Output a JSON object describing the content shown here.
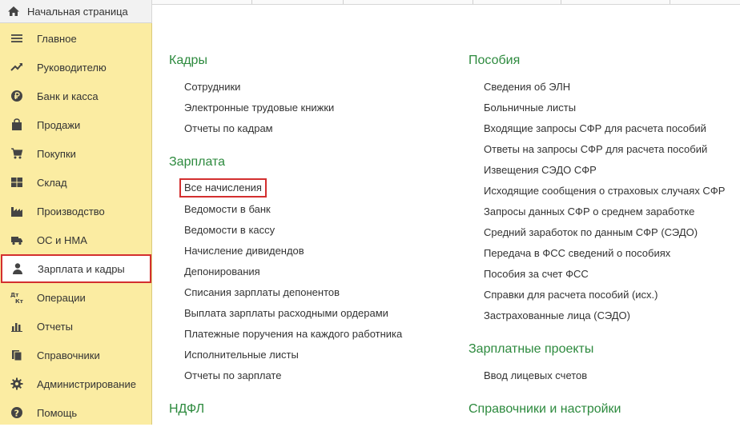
{
  "top_bar": {
    "home_label": "Начальная страница"
  },
  "sidebar": {
    "items": [
      {
        "label": "Главное",
        "icon": "menu-icon"
      },
      {
        "label": "Руководителю",
        "icon": "trend-icon"
      },
      {
        "label": "Банк и касса",
        "icon": "ruble-icon"
      },
      {
        "label": "Продажи",
        "icon": "bag-icon"
      },
      {
        "label": "Покупки",
        "icon": "cart-icon"
      },
      {
        "label": "Склад",
        "icon": "grid-icon"
      },
      {
        "label": "Производство",
        "icon": "factory-icon"
      },
      {
        "label": "ОС и НМА",
        "icon": "truck-icon"
      },
      {
        "label": "Зарплата и кадры",
        "icon": "person-icon",
        "active": true
      },
      {
        "label": "Операции",
        "icon": "dt-kt-icon"
      },
      {
        "label": "Отчеты",
        "icon": "bar-chart-icon"
      },
      {
        "label": "Справочники",
        "icon": "books-icon"
      },
      {
        "label": "Администрирование",
        "icon": "gear-icon"
      },
      {
        "label": "Помощь",
        "icon": "help-icon"
      }
    ]
  },
  "left_column": {
    "kadry": {
      "title": "Кадры",
      "links": [
        "Сотрудники",
        "Электронные трудовые книжки",
        "Отчеты по кадрам"
      ]
    },
    "zarplata": {
      "title": "Зарплата",
      "links": [
        "Все начисления",
        "Ведомости в банк",
        "Ведомости в кассу",
        "Начисление дивидендов",
        "Депонирования",
        "Списания зарплаты депонентов",
        "Выплата зарплаты расходными ордерами",
        "Платежные поручения на каждого работника",
        "Исполнительные листы",
        "Отчеты по зарплате"
      ]
    },
    "ndfl": {
      "title": "НДФЛ"
    }
  },
  "right_column": {
    "posobiya": {
      "title": "Пособия",
      "links": [
        "Сведения об ЭЛН",
        "Больничные листы",
        "Входящие запросы СФР для расчета пособий",
        "Ответы на запросы СФР для расчета пособий",
        "Извещения СЭДО СФР",
        "Исходящие сообщения о страховых случаях СФР",
        "Запросы данных СФР о среднем заработке",
        "Средний заработок по данным СФР (СЭДО)",
        "Передача в ФСС сведений о пособиях",
        "Пособия за счет ФСС",
        "Справки для расчета пособий (исх.)",
        "Застрахованные лица (СЭДО)"
      ]
    },
    "projects": {
      "title": "Зарплатные проекты",
      "links": [
        "Ввод лицевых счетов"
      ]
    },
    "settings": {
      "title": "Справочники и настройки"
    }
  },
  "colors": {
    "sidebar_bg": "#fbeca2",
    "section_title": "#2d8a3e",
    "highlight_border": "#d32f2f"
  }
}
